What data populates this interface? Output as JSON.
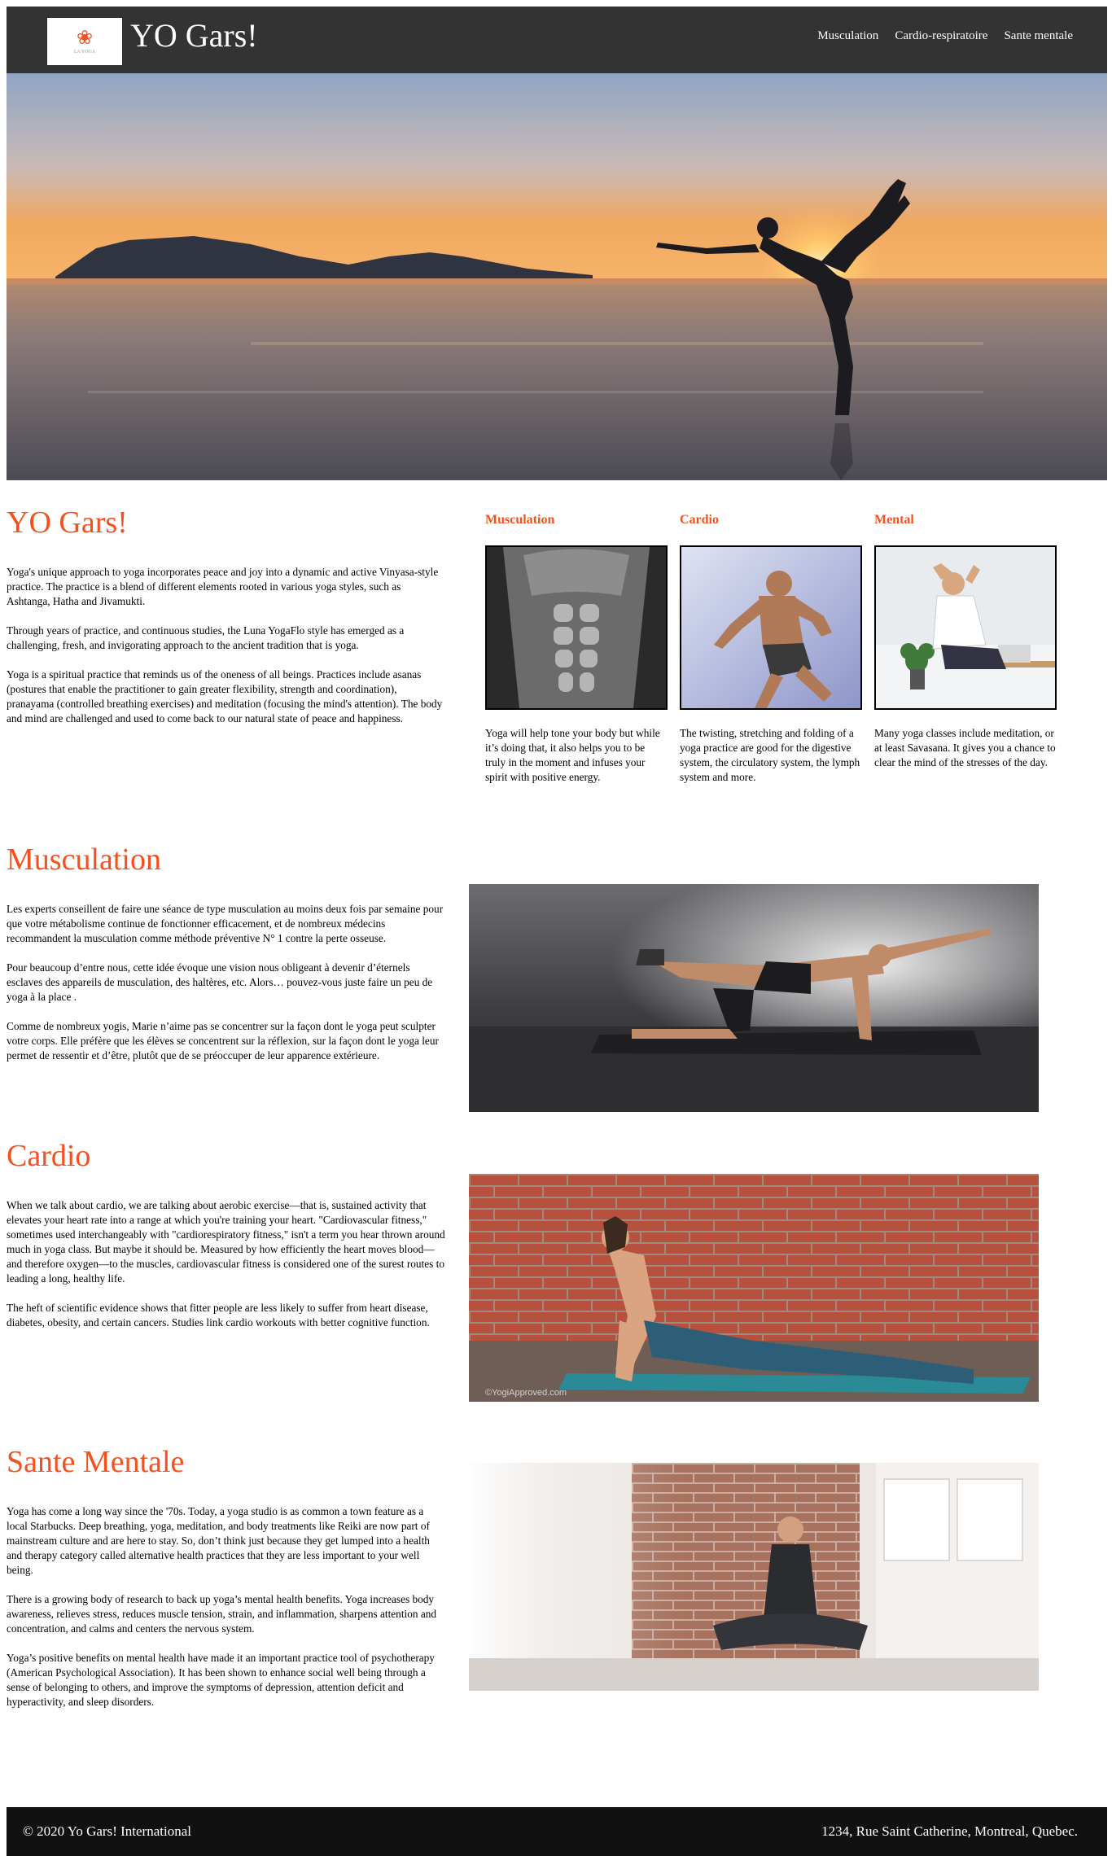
{
  "nav": {
    "brand": "YO Gars!",
    "logo_text": "LA YOGA",
    "links": [
      "Musculation",
      "Cardio-respiratoire",
      "Sante mentale"
    ]
  },
  "intro": {
    "title": "YO Gars!",
    "paragraphs": [
      "Yoga's unique approach to yoga incorporates peace and joy into a dynamic and active Vinyasa-style practice. The practice is a blend of different elements rooted in various yoga styles, such as Ashtanga, Hatha and Jivamukti.",
      "Through years of practice, and continuous studies, the Luna YogaFlo style has emerged as a challenging, fresh, and invigorating approach to the ancient tradition that is yoga.",
      "Yoga is a spiritual practice that reminds us of the oneness of all beings. Practices include asanas (postures that enable the practitioner to gain greater flexibility, strength and coordination), pranayama (controlled breathing exercises) and meditation (focusing the mind's attention). The body and mind are challenged and used to come back to our natural state of peace and happiness."
    ]
  },
  "features": [
    {
      "title": "Musculation",
      "text": "Yoga will help tone your body but while it’s doing that, it also helps you to be truly in the moment and infuses your spirit with positive energy."
    },
    {
      "title": "Cardio",
      "text": "The twisting, stretching and folding of a yoga practice are good for the digestive system, the circulatory system, the lymph system and more."
    },
    {
      "title": "Mental",
      "text": "Many yoga classes include meditation, or at least Savasana. It gives you a chance to clear the mind of the stresses of the day."
    }
  ],
  "musculation": {
    "title": "Musculation",
    "paragraphs": [
      "Les experts conseillent de faire une séance de type musculation au moins deux fois par semaine pour que votre métabolisme continue de fonctionner efficacement, et de nombreux médecins recommandent la musculation comme méthode préventive N° 1 contre la perte osseuse.",
      "Pour beaucoup d’entre nous, cette idée évoque une vision nous obligeant à devenir d’éternels esclaves des appareils de musculation, des haltères, etc. Alors… pouvez-vous juste faire un peu de yoga à la place .",
      "Comme de nombreux yogis, Marie n’aime pas se concentrer sur la façon dont le yoga peut sculpter votre corps. Elle préfère que les élèves se concentrent sur la réflexion, sur la façon dont le yoga leur permet de ressentir et d’être, plutôt que de se préoccuper de leur apparence extérieure."
    ]
  },
  "cardio": {
    "title": "Cardio",
    "watermark": "©YogiApproved.com",
    "paragraphs": [
      "When we talk about cardio, we are talking about aerobic exercise—that is, sustained activity that elevates your heart rate into a range at which you're training your heart. \"Cardiovascular fitness,\" sometimes used interchangeably with \"cardiorespiratory fitness,\" isn't a term you hear thrown around much in yoga class. But maybe it should be. Measured by how efficiently the heart moves blood—and therefore oxygen—to the muscles, cardiovascular fitness is considered one of the surest routes to leading a long, healthy life.",
      "The heft of scientific evidence shows that fitter people are less likely to suffer from heart disease, diabetes, obesity, and certain cancers. Studies link cardio workouts with better cognitive function."
    ]
  },
  "mental": {
    "title": "Sante Mentale",
    "paragraphs": [
      "Yoga has come a long way since the '70s. Today, a yoga studio is as common a town feature as a local Starbucks. Deep breathing, yoga, meditation, and body treatments like Reiki are now part of mainstream culture and are here to stay. So, don’t think just because they get lumped into a health and therapy category called alternative health practices that they are less important to your well being.",
      "There is a growing body of research to back up yoga’s mental health benefits. Yoga increases body awareness, relieves stress, reduces muscle tension, strain, and inflammation, sharpens attention and concentration, and calms and centers the nervous system.",
      "Yoga’s positive benefits on mental health have made it an important practice tool of psychotherapy (American Psychological Association). It has been shown to enhance social well being through a sense of belonging to others, and improve the symptoms of depression, attention deficit and hyperactivity, and sleep disorders."
    ]
  },
  "footer": {
    "left": "© 2020 Yo Gars! International",
    "right": "1234, Rue Saint Catherine, Montreal, Quebec."
  },
  "colors": {
    "accent": "#f4511e",
    "nav_bg": "#333333",
    "footer_bg": "#111111"
  }
}
